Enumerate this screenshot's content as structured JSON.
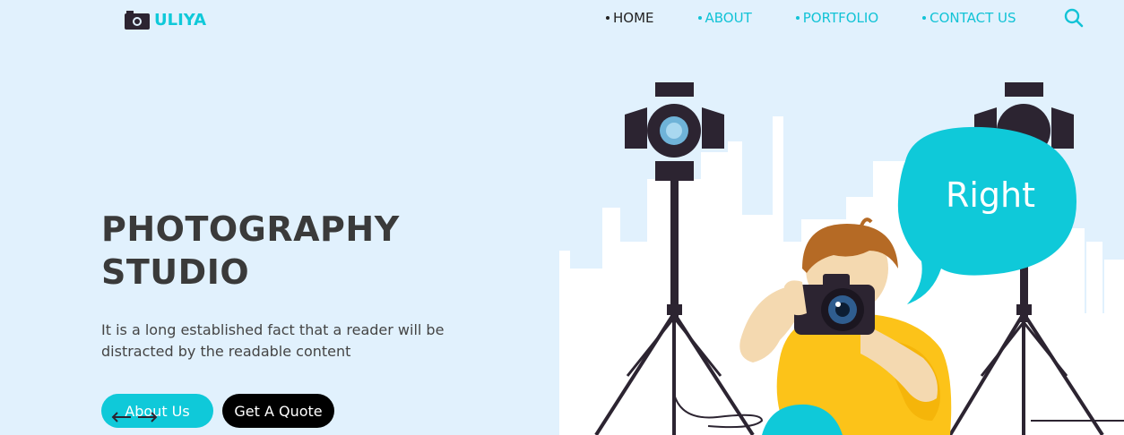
{
  "brand": {
    "name": "ULIYA",
    "icon": "camera-icon"
  },
  "nav": {
    "items": [
      {
        "label": "HOME",
        "active": true
      },
      {
        "label": "ABOUT",
        "active": false
      },
      {
        "label": "PORTFOLIO",
        "active": false
      },
      {
        "label": "CONTACT US",
        "active": false
      }
    ],
    "search_icon": "search-icon"
  },
  "hero": {
    "title_line1": "PHOTOGRAPHY",
    "title_line2": "STUDIO",
    "description": "It is a long established fact that a reader will be distracted by the readable content",
    "about_button": "About Us",
    "quote_button": "Get A Quote"
  },
  "illustration": {
    "bubble_text": "Right"
  },
  "colors": {
    "accent": "#0fc9d9",
    "background": "#e1f1fd",
    "title": "#3a3a3a",
    "dark": "#000000"
  }
}
